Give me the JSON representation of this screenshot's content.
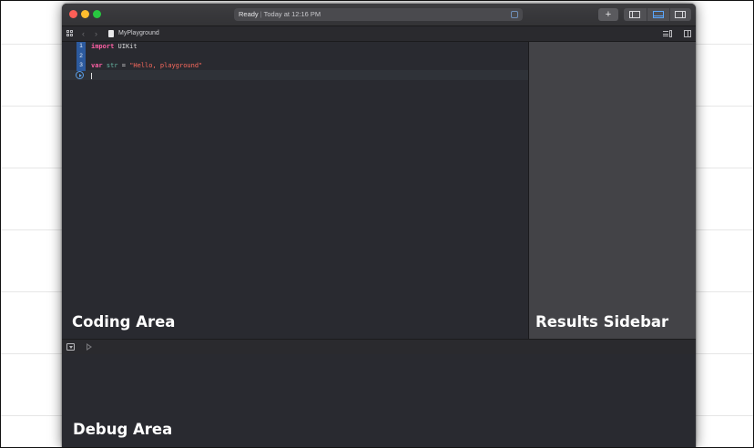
{
  "window": {
    "status": {
      "ready": "Ready",
      "separator": "|",
      "time": "Today at 12:16 PM"
    },
    "toolbar": {
      "add_label": "+",
      "accent": "#5aa7ff"
    }
  },
  "jumpbar": {
    "file_name": "MyPlayground",
    "back_icon": "chevron-left-icon",
    "forward_icon": "chevron-right-icon"
  },
  "editor": {
    "line_numbers": [
      "1",
      "2",
      "3"
    ],
    "code": {
      "line1": {
        "keyword": "import",
        "rest": " UIKit"
      },
      "line3": {
        "keyword": "var",
        "name": "str",
        "operator": " = ",
        "string": "\"Hello, playground\""
      }
    },
    "colors": {
      "keyword": "#fc5fa3",
      "string": "#fc6a5d",
      "identifier": "#67b7a4"
    }
  },
  "labels": {
    "coding_area": "Coding Area",
    "results_sidebar": "Results Sidebar",
    "debug_area": "Debug Area"
  }
}
